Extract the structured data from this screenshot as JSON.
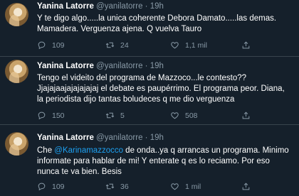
{
  "tweets": [
    {
      "name": "Yanina Latorre",
      "handle": "@yanilatorre",
      "sep": "·",
      "time": "19h",
      "text": "Y te digo algo.....la unica coherente Debora Damato.....las demas. Mamadera. Verguenza ajena. Q vuelva Tauro",
      "replies": "109",
      "retweets": "24",
      "likes": "1,1 mil"
    },
    {
      "name": "Yanina Latorre",
      "handle": "@yanilatorre",
      "sep": "·",
      "time": "19h",
      "text": "Tengo el videito del programa de Mazzoco...le contesto?? Jjajajaajajajajajaj el debate es paupérrimo. El programa peor. Diana, la periodista dijo tantas boludeces q me dio verguenza",
      "replies": "150",
      "retweets": "5",
      "likes": "508"
    },
    {
      "name": "Yanina Latorre",
      "handle": "@yanilatorre",
      "sep": "·",
      "time": "19h",
      "text_before": "Che ",
      "mention": "@Karinamazzocco",
      "text_after": " de onda..ya q arrancas un programa. Minimo informate para hablar de mi! Y enterate q es lo reciamo. Por eso nunca te va bien. Besis",
      "replies": "109",
      "retweets": "36",
      "likes": "1 mil"
    }
  ],
  "icons": {
    "reply": "reply-icon",
    "retweet": "retweet-icon",
    "like": "like-icon",
    "share": "share-icon"
  },
  "colors": {
    "background": "#15202b",
    "text": "#ffffff",
    "secondary": "#8899a6",
    "link": "#1da1f2",
    "divider": "#38444d"
  }
}
